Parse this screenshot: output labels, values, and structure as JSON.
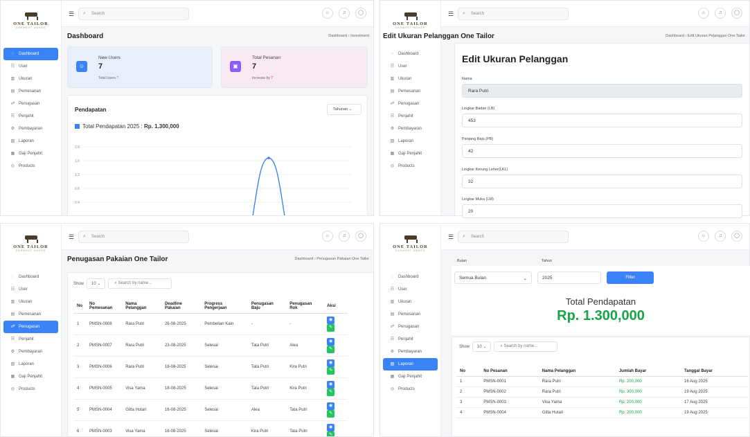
{
  "brand": {
    "name": "ONE TAILOR",
    "tagline": "GARMENT MAKER"
  },
  "search_placeholder": "Search",
  "menu": [
    "Dashboard",
    "User",
    "Ukuran",
    "Pemesanan",
    "Penugasan",
    "Penjahit",
    "Pembayaran",
    "Laporan",
    "Gaji Penjahit",
    "Products"
  ],
  "icons": {
    "menu": "hamburger-icon",
    "theme": "sun-icon",
    "notif": "bell-icon",
    "user": "avatar-icon"
  },
  "colors": {
    "accent": "#3b82f6",
    "success": "#16a34a",
    "purple": "#8b5cf6"
  },
  "dashboard": {
    "title": "Dashboard",
    "breadcrumb": "Dashboard › Investment",
    "cards": [
      {
        "label": "New Users",
        "value": "7",
        "sub": "Total Users",
        "badge": "?"
      },
      {
        "label": "Total Pesanan",
        "value": "7",
        "sub": "Increase by",
        "badge": "?"
      }
    ],
    "income_title": "Pendapatan",
    "period": "Tahunan",
    "legend": "Total Pendapatan 2025 : ",
    "legend_value": "Rp. 1.300,000"
  },
  "chart_data": {
    "type": "line",
    "title": "",
    "series": [
      {
        "name": "Total Pendapatan 2025",
        "values": [
          0,
          0,
          0,
          1300000,
          0,
          0
        ]
      }
    ],
    "y_ticks": [
      "2.0",
      "1.6",
      "1.2",
      "0.8",
      "0.4"
    ],
    "grid": true
  },
  "edit": {
    "page_title": "Edit Ukuran Pelanggan One Tailor",
    "breadcrumb": "Dashboard › Edit Ukuran Pelanggan One Tailor",
    "form_title": "Edit Ukuran Pelanggan",
    "fields": [
      {
        "label": "Nama",
        "value": "Rara Putri"
      },
      {
        "label": "Lingkar Badan (LB)",
        "value": "453"
      },
      {
        "label": "Panjang Baju (PB)",
        "value": "42"
      },
      {
        "label": "Lingkar Kerung Leher(LKL)",
        "value": "32"
      },
      {
        "label": "Lingkar Muka (LM)",
        "value": "20"
      }
    ]
  },
  "penugasan": {
    "title": "Penugasan Pakaian One Tailor",
    "breadcrumb": "Dashboard › Penugasan Pakaian One Tailor",
    "show_label": "Show",
    "show_value": "10",
    "search_placeholder": "Search by name...",
    "headers": [
      "No",
      "No Pemesanan",
      "Nama Pelanggan",
      "Deadline Pakaian",
      "Progress Pengerjaan",
      "Penugasan Baju",
      "Penugasan Rok",
      "Aksi"
    ],
    "rows": [
      [
        "1",
        "PMSN-0008",
        "Rara Putri",
        "26-08-2025",
        "Pembelian Kain",
        "-",
        "-"
      ],
      [
        "2",
        "PMSN-0007",
        "Rara Putri",
        "23-08-2025",
        "Selesai",
        "Tata Putri",
        "Alea"
      ],
      [
        "3",
        "PMSN-0006",
        "Rara Putri",
        "18-08-2025",
        "Selesai",
        "Tata Putri",
        "Kira Putri"
      ],
      [
        "4",
        "PMSN-0005",
        "Visa Yama",
        "18-08-2025",
        "Selesai",
        "Tata Putri",
        "Kira Putri"
      ],
      [
        "5",
        "PMSN-0004",
        "Gitta Hutari",
        "16-08-2025",
        "Selesai",
        "Alea",
        "Tata Putri"
      ],
      [
        "6",
        "PMSN-0003",
        "Visa Yama",
        "16-08-2025",
        "Selesai",
        "Kira Putri",
        "Tata Putri"
      ]
    ]
  },
  "laporan": {
    "bulan_label": "Bulan",
    "bulan_value": "Semua Bulan",
    "tahun_label": "Tahun",
    "tahun_value": "2025",
    "filter_label": "Filter",
    "total_label": "Total Pendapatan",
    "total_value": "Rp. 1.300,000",
    "show_label": "Show",
    "show_value": "10",
    "search_placeholder": "Search by name...",
    "headers": [
      "No",
      "No Pesanan",
      "Nama Pelanggan",
      "Jumlah Bayar",
      "Tanggal Bayar"
    ],
    "rows": [
      [
        "1",
        "PMSN-0001",
        "Rara Putri",
        "Rp. 200,000",
        "16 Aug 2025"
      ],
      [
        "2",
        "PMSN-0002",
        "Rara Putri",
        "Rp. 300,000",
        "19 Aug 2025"
      ],
      [
        "3",
        "PMSN-0003",
        "Visa Yama",
        "Rp. 200,000",
        "17 Aug 2025"
      ],
      [
        "4",
        "PMSN-0004",
        "Gitta Hutari",
        "Rp. 200,000",
        "19 Aug 2025"
      ]
    ]
  }
}
